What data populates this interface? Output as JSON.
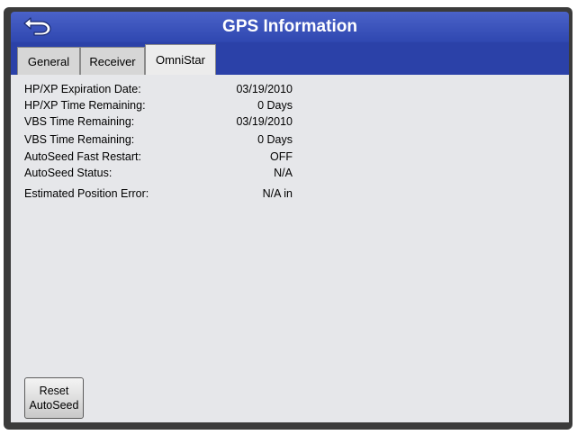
{
  "header": {
    "title": "GPS Information",
    "back_icon": "back-arrow-icon"
  },
  "tabs": [
    {
      "label": "General",
      "active": false
    },
    {
      "label": "Receiver",
      "active": false
    },
    {
      "label": "OmniStar",
      "active": true
    }
  ],
  "info_rows": [
    {
      "label": "HP/XP Expiration Date:",
      "value": "03/19/2010"
    },
    {
      "label": "HP/XP Time Remaining:",
      "value": "0 Days"
    },
    {
      "label": "VBS Time Remaining:",
      "value": "03/19/2010"
    },
    {
      "label": "VBS Time Remaining:",
      "value": "0 Days"
    },
    {
      "label": "AutoSeed Fast Restart:",
      "value": "OFF"
    },
    {
      "label": "AutoSeed Status:",
      "value": "N/A"
    },
    {
      "label": "Estimated Position Error:",
      "value": "N/A in"
    }
  ],
  "reset_button": {
    "line1": "Reset",
    "line2": "AutoSeed"
  },
  "colors": {
    "titlebar": "#3a52bd",
    "panel": "#e6e7ea",
    "frame": "#3b3b3b"
  }
}
